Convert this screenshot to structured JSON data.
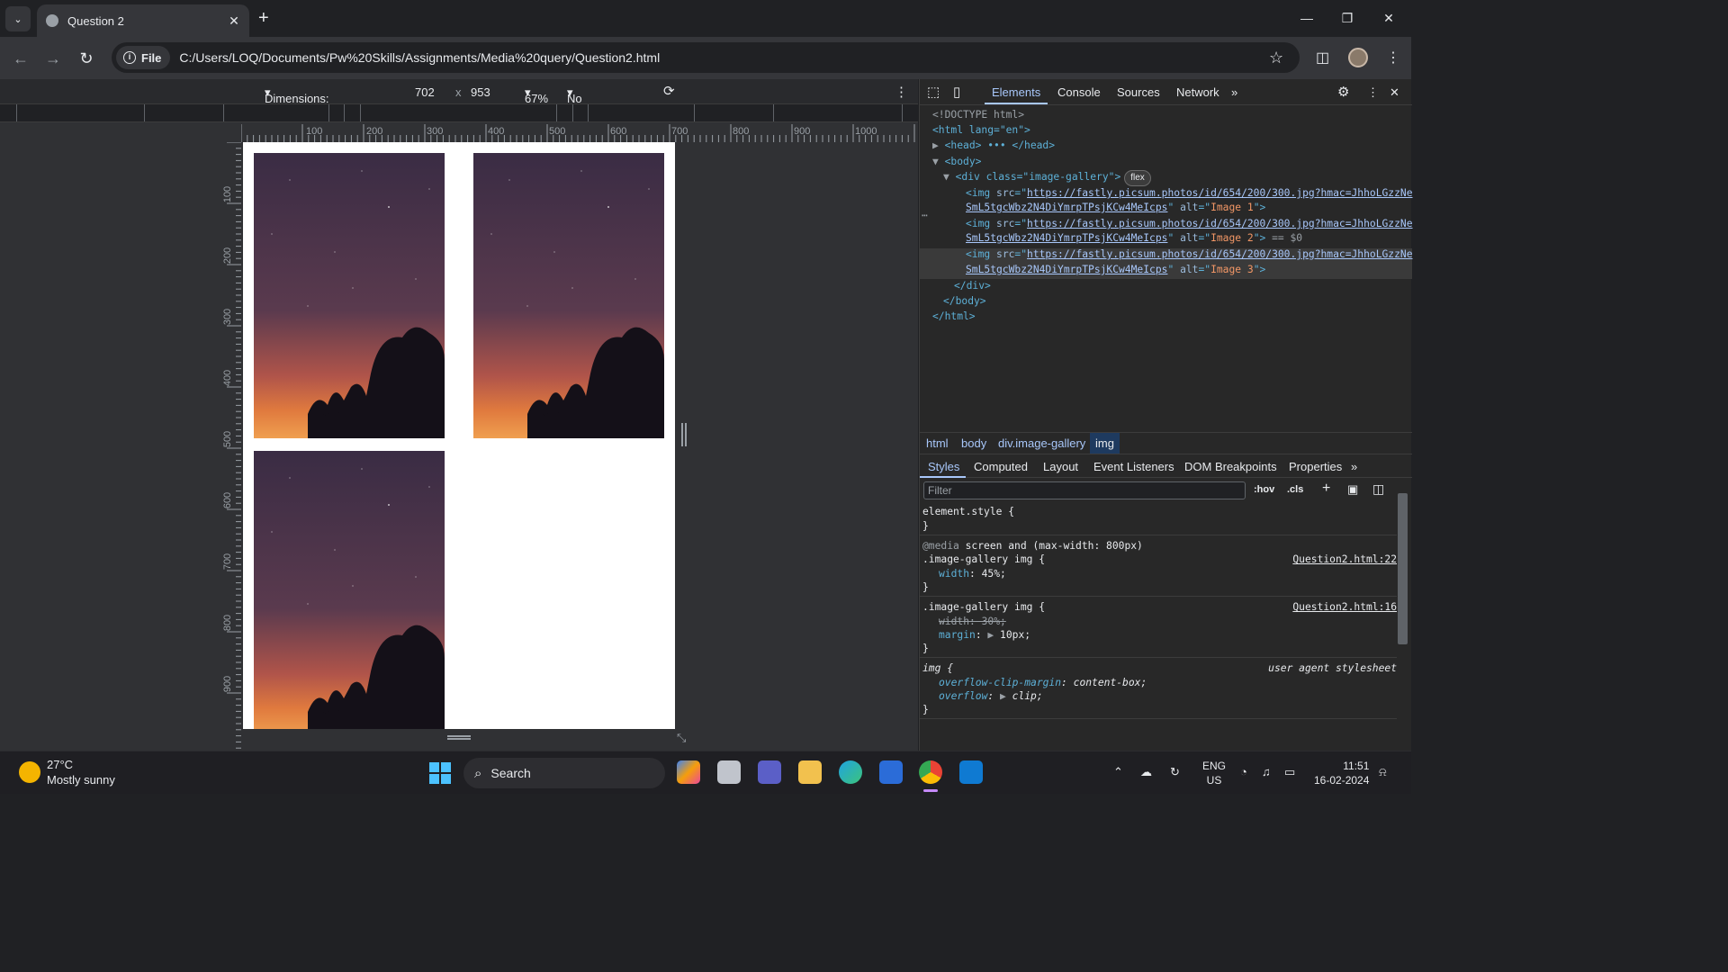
{
  "browser": {
    "tab_title": "Question 2",
    "file_chip": "File",
    "url": "C:/Users/LOQ/Documents/Pw%20Skills/Assignments/Media%20query/Question2.html"
  },
  "device_toolbar": {
    "dimensions": "Dimensions: Responsive",
    "width": "702",
    "times": "x",
    "height": "953",
    "zoom": "67%",
    "throttling": "No throttling"
  },
  "rulers": {
    "h_labels": [
      "100",
      "200",
      "300",
      "400",
      "500",
      "600",
      "700",
      "800",
      "900",
      "1000"
    ],
    "v_labels": [
      "100",
      "200",
      "300",
      "400",
      "500",
      "600",
      "700",
      "800",
      "900"
    ]
  },
  "devtools": {
    "tabs": [
      "Elements",
      "Console",
      "Sources",
      "Network"
    ],
    "active_tab": "Elements",
    "dom": {
      "doctype": "<!DOCTYPE html>",
      "html_open": "<html lang=\"en\">",
      "head": "<head> ••• </head>",
      "body_open": "<body>",
      "div_open": "<div class=\"image-gallery\">",
      "flex_badge": "flex",
      "img_src_1": "https://fastly.picsum.photos/id/654/200/300.jpg?hmac=JhhoLGzzNe",
      "img_src_2": "SmL5tgcWbz2N4DiYmrpTPsjKCw4MeIcps",
      "alt_1": "Image 1",
      "alt_2": "Image 2",
      "alt_3": "Image 3",
      "selected_marker": "== $0",
      "div_close": "</div>",
      "body_close": "</body>",
      "html_close": "</html>"
    },
    "breadcrumbs": [
      "html",
      "body",
      "div.image-gallery",
      "img"
    ],
    "sub_tabs": [
      "Styles",
      "Computed",
      "Layout",
      "Event Listeners",
      "DOM Breakpoints",
      "Properties"
    ],
    "filter_placeholder": "Filter",
    "filter_buttons": [
      ":hov",
      ".cls"
    ],
    "styles": {
      "element_style": "element.style {",
      "media_at": "@media",
      "media_query": "screen and (max-width: 800px)",
      "rule1_selector": ".image-gallery img {",
      "rule1_source": "Question2.html:22",
      "rule1_prop": "width",
      "rule1_val": "45%;",
      "rule2_selector": ".image-gallery img {",
      "rule2_source": "Question2.html:16",
      "rule2_prop_struck": "width: 30%;",
      "rule2_prop": "margin",
      "rule2_val": "10px;",
      "ua_selector": "img {",
      "ua_source": "user agent stylesheet",
      "ua_prop1": "overflow-clip-margin",
      "ua_val1": "content-box;",
      "ua_prop2": "overflow",
      "ua_val2": "clip;",
      "close_brace": "}"
    }
  },
  "taskbar": {
    "temperature": "27°C",
    "weather": "Mostly sunny",
    "search": "Search",
    "lang1": "ENG",
    "lang2": "US",
    "time": "11:51",
    "date": "16-02-2024"
  }
}
